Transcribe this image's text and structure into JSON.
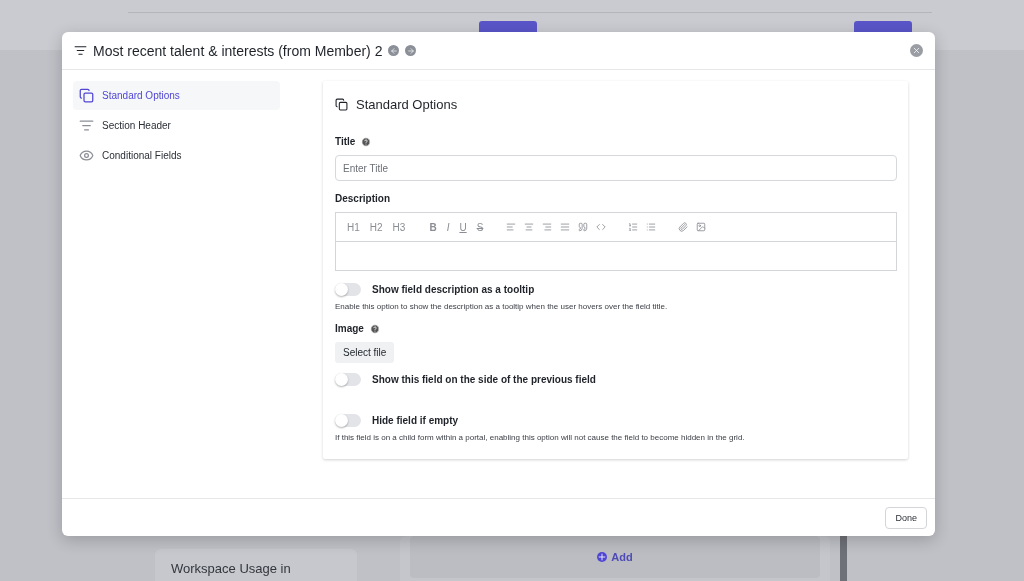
{
  "background": {
    "usage_card_title": "Workspace Usage in",
    "add_button": "Add"
  },
  "modal": {
    "title": "Most recent talent & interests (from Member) 2",
    "sidebar": [
      {
        "label": "Standard Options",
        "selected": true
      },
      {
        "label": "Section Header",
        "selected": false
      },
      {
        "label": "Conditional Fields",
        "selected": false
      }
    ],
    "panel_title": "Standard Options",
    "title_field": {
      "label": "Title",
      "placeholder": "Enter Title"
    },
    "description": {
      "label": "Description",
      "toolbar": [
        {
          "label": "H1",
          "kind": "heading"
        },
        {
          "label": "H2",
          "kind": "heading"
        },
        {
          "label": "H3",
          "kind": "heading"
        },
        {
          "label": "B",
          "kind": "bold"
        },
        {
          "label": "I",
          "kind": "italic"
        },
        {
          "label": "U",
          "kind": "underline"
        },
        {
          "label": "S",
          "kind": "strike"
        }
      ]
    },
    "tooltip_toggle": {
      "label": "Show field description as a tooltip",
      "on": false,
      "help": "Enable this option to show the description as a tooltip when the user hovers over the field title."
    },
    "image": {
      "label": "Image",
      "button": "Select file"
    },
    "side_toggle": {
      "label": "Show this field on the side of the previous field",
      "on": false
    },
    "hide_toggle": {
      "label": "Hide field if empty",
      "on": false,
      "help": "If this field is on a child form within a portal, enabling this option will not cause the field to become hidden in the grid."
    },
    "done_button": "Done"
  }
}
